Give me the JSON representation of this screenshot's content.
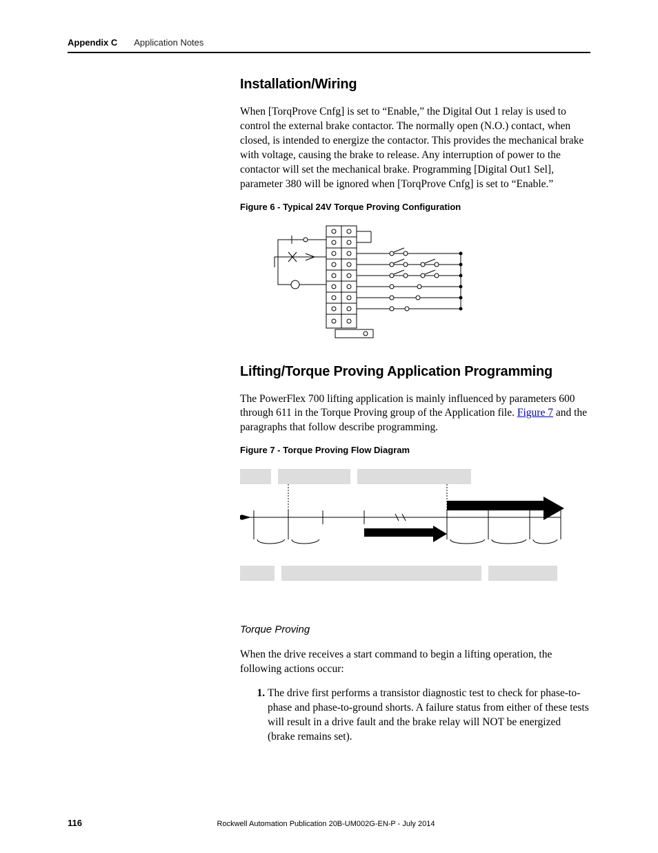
{
  "header": {
    "appendix": "Appendix C",
    "title": "Application Notes"
  },
  "section1": {
    "heading": "Installation/Wiring",
    "paragraph": "When [TorqProve Cnfg] is set to “Enable,” the Digital Out 1 relay is used to control the external brake contactor. The normally open (N.O.) contact, when closed, is intended to energize the contactor. This provides the mechanical brake with voltage, causing the brake to release. Any interruption of power to the contactor will set the mechanical brake. Programming [Digital Out1 Sel], parameter 380 will be ignored when [TorqProve Cnfg] is set to “Enable.”",
    "figure_caption": "Figure 6 - Typical 24V Torque Proving Configuration"
  },
  "section2": {
    "heading": "Lifting/Torque Proving Application Programming",
    "paragraph_before_link": "The PowerFlex 700 lifting application is mainly influenced by parameters 600 through 611 in the Torque Proving group of the Application file. ",
    "link_text": "Figure 7",
    "paragraph_after_link": " and the paragraphs that follow describe programming.",
    "figure_caption": "Figure 7 - Torque Proving Flow Diagram"
  },
  "subsection": {
    "heading": "Torque Proving",
    "intro": "When the drive receives a start command to begin a lifting operation, the following actions occur:",
    "steps": [
      "The drive first performs a transistor diagnostic test to check for phase-to-phase and phase-to-ground shorts. A failure status from either of these tests will result in a drive fault and the brake relay will NOT be energized (brake remains set)."
    ]
  },
  "footer": {
    "page": "116",
    "publication": "Rockwell Automation Publication 20B-UM002G-EN-P - July 2014"
  }
}
